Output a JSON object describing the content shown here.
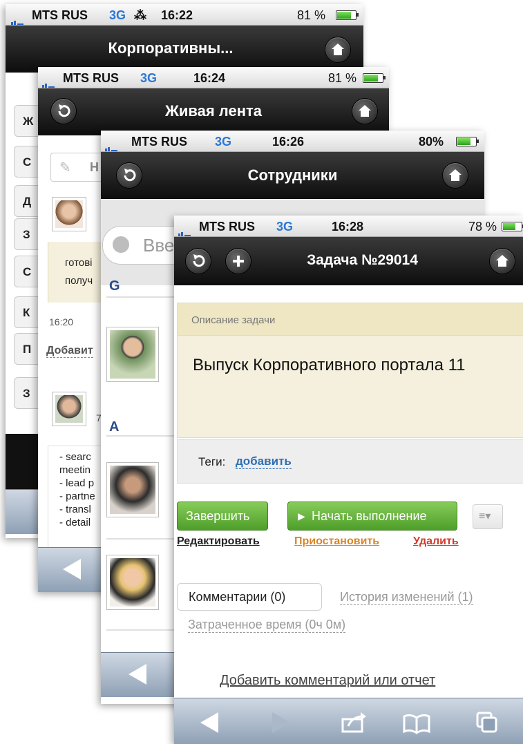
{
  "screen1": {
    "carrier": "MTS RUS",
    "network": "3G",
    "time": "16:22",
    "battery": "81 %",
    "title": "Корпоративны...",
    "menu": [
      "Ж",
      "С",
      "Д",
      "З",
      "С",
      "К",
      "П"
    ],
    "menu2": "З"
  },
  "screen2": {
    "carrier": "MTS RUS",
    "network": "3G",
    "time": "16:24",
    "battery": "81 %",
    "title": "Живая лента",
    "input_placeholder": "Н",
    "post1_text_line1": "готові",
    "post1_text_line2": "получ",
    "post1_time": "16:20",
    "add_link": "Добавит",
    "post2_meta": "7",
    "list": [
      "- searc",
      "meetin",
      "- lead p",
      "- partne",
      "- transl",
      "- detail"
    ]
  },
  "screen3": {
    "carrier": "MTS RUS",
    "network": "3G",
    "time": "16:26",
    "battery": "80%",
    "title": "Сотрудники",
    "search_placeholder": "Вве",
    "group1": "G",
    "group2": "A"
  },
  "screen4": {
    "carrier": "MTS RUS",
    "network": "3G",
    "time": "16:28",
    "battery": "78 %",
    "title": "Задача №29014",
    "desc_label": "Описание задачи",
    "desc_text": "Выпуск Корпоративного портала 11",
    "tags_label": "Теги:",
    "tags_add": "добавить",
    "btn_complete": "Завершить",
    "btn_start": "Начать выполнение",
    "link_edit": "Редактировать",
    "link_pause": "Приостановить",
    "link_delete": "Удалить",
    "tab_comments": "Комментарии (0)",
    "tab_history": "История изменений (1)",
    "tab_time": "Затраченное время (0ч 0м)",
    "add_comment": "Добавить комментарий или отчет"
  },
  "colors": {
    "link_blue": "#2f6fb3",
    "link_orange": "#d8862a",
    "link_red": "#d23b2b",
    "green": "#5aa832",
    "beige": "#f5f0dd"
  }
}
